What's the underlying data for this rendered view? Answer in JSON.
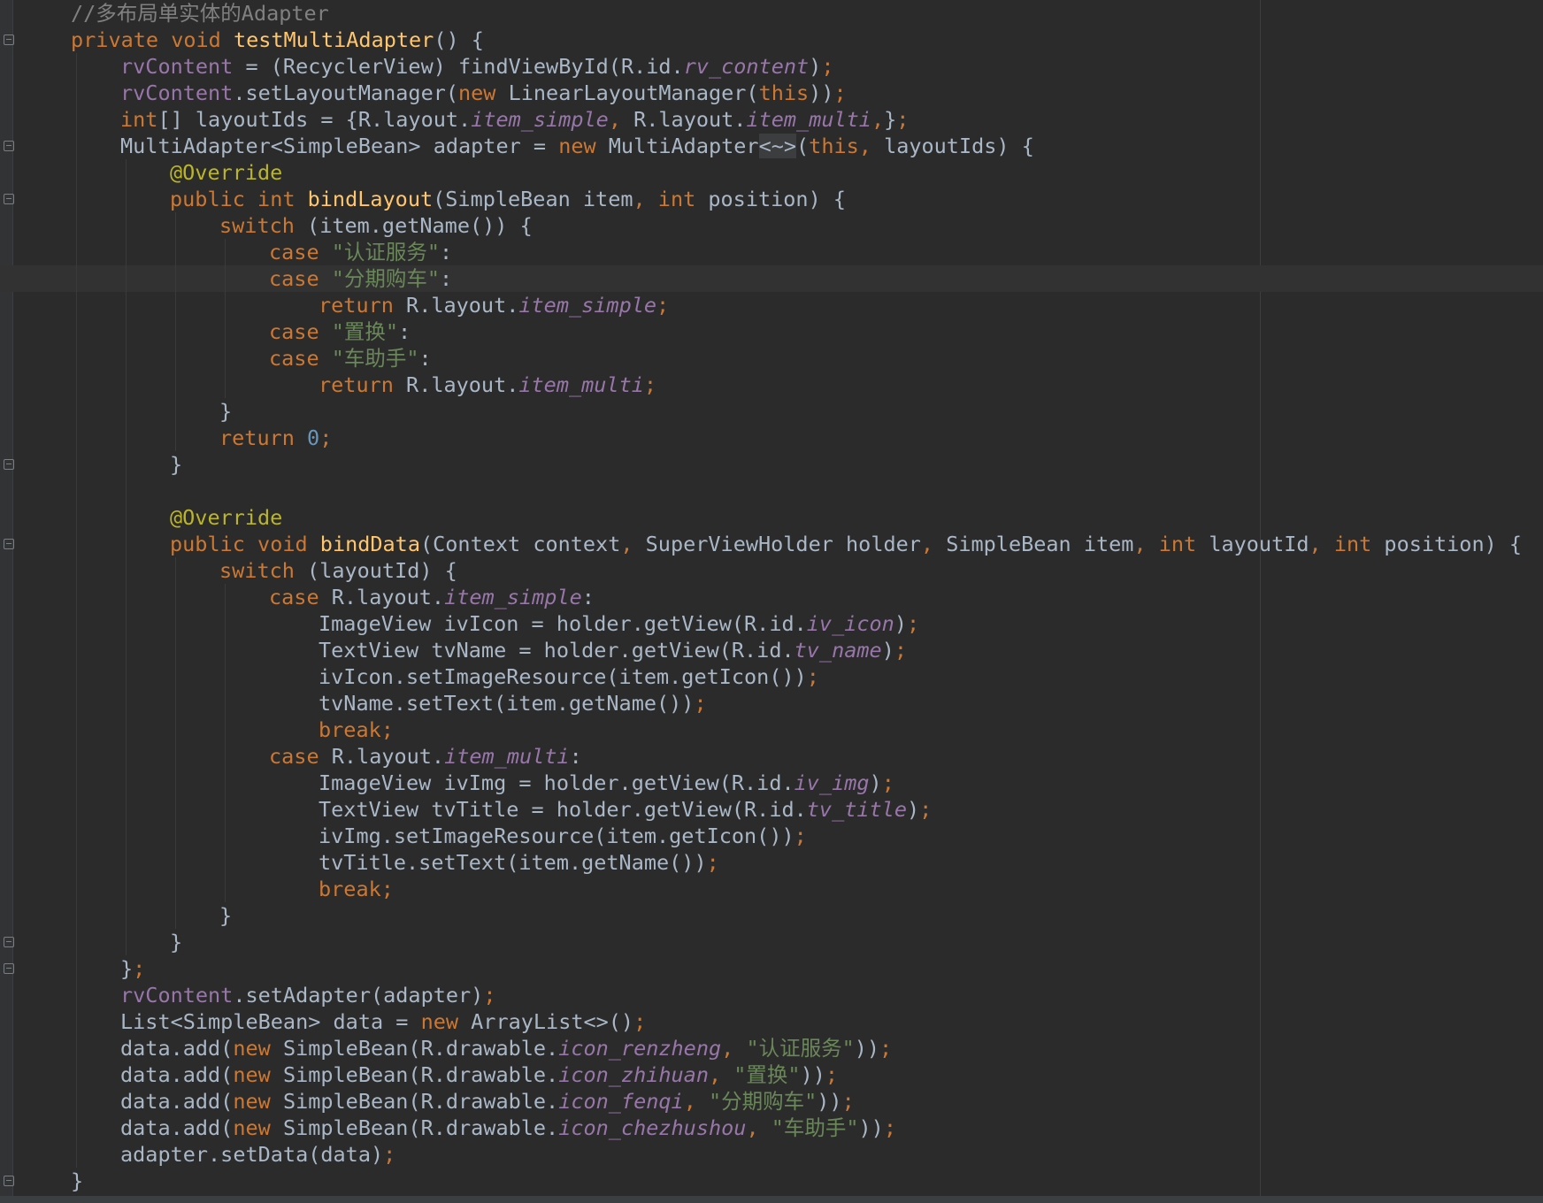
{
  "editor": {
    "lines": [
      {
        "indent": 0,
        "tokens": [
          {
            "t": "//多布局单实体的Adapter",
            "c": "c"
          }
        ]
      },
      {
        "indent": 0,
        "fold": true,
        "tokens": [
          {
            "t": "private ",
            "c": "k"
          },
          {
            "t": "void ",
            "c": "k"
          },
          {
            "t": "testMultiAdapter",
            "c": "m"
          },
          {
            "t": "() {",
            "c": "p"
          }
        ]
      },
      {
        "indent": 1,
        "tokens": [
          {
            "t": "rvContent",
            "c": "f"
          },
          {
            "t": " = (RecyclerView) findViewById(R.id.",
            "c": "p"
          },
          {
            "t": "rv_content",
            "c": "fi"
          },
          {
            "t": ")",
            "c": "p"
          },
          {
            "t": ";",
            "c": "k"
          }
        ]
      },
      {
        "indent": 1,
        "tokens": [
          {
            "t": "rvContent",
            "c": "f"
          },
          {
            "t": ".setLayoutManager(",
            "c": "p"
          },
          {
            "t": "new ",
            "c": "k"
          },
          {
            "t": "LinearLayoutManager(",
            "c": "p"
          },
          {
            "t": "this",
            "c": "k"
          },
          {
            "t": "))",
            "c": "p"
          },
          {
            "t": ";",
            "c": "k"
          }
        ]
      },
      {
        "indent": 1,
        "tokens": [
          {
            "t": "int",
            "c": "k"
          },
          {
            "t": "[] layoutIds = {R.layout.",
            "c": "p"
          },
          {
            "t": "item_simple",
            "c": "fi"
          },
          {
            "t": ", ",
            "c": "k"
          },
          {
            "t": "R.layout.",
            "c": "p"
          },
          {
            "t": "item_multi",
            "c": "fi"
          },
          {
            "t": ",",
            "c": "k"
          },
          {
            "t": "}",
            "c": "p"
          },
          {
            "t": ";",
            "c": "k"
          }
        ]
      },
      {
        "indent": 1,
        "fold": true,
        "tokens": [
          {
            "t": "MultiAdapter<SimpleBean> adapter = ",
            "c": "p"
          },
          {
            "t": "new ",
            "c": "k"
          },
          {
            "t": "MultiAdapter",
            "c": "p"
          },
          {
            "t": "<~>",
            "c": "d"
          },
          {
            "t": "(",
            "c": "p"
          },
          {
            "t": "this",
            "c": "k"
          },
          {
            "t": ", ",
            "c": "k"
          },
          {
            "t": "layoutIds) {",
            "c": "p"
          }
        ]
      },
      {
        "indent": 2,
        "tokens": [
          {
            "t": "@Override",
            "c": "a"
          }
        ]
      },
      {
        "indent": 2,
        "fold": true,
        "tokens": [
          {
            "t": "public ",
            "c": "k"
          },
          {
            "t": "int ",
            "c": "k"
          },
          {
            "t": "bindLayout",
            "c": "m"
          },
          {
            "t": "(SimpleBean item",
            "c": "p"
          },
          {
            "t": ", ",
            "c": "k"
          },
          {
            "t": "int ",
            "c": "k"
          },
          {
            "t": "position) {",
            "c": "p"
          }
        ]
      },
      {
        "indent": 3,
        "tokens": [
          {
            "t": "switch ",
            "c": "k"
          },
          {
            "t": "(item.getName()) {",
            "c": "p"
          }
        ]
      },
      {
        "indent": 4,
        "tokens": [
          {
            "t": "case ",
            "c": "k"
          },
          {
            "t": "\"认证服务\"",
            "c": "s"
          },
          {
            "t": ":",
            "c": "p"
          }
        ]
      },
      {
        "indent": 4,
        "current": true,
        "tokens": [
          {
            "t": "case ",
            "c": "k"
          },
          {
            "t": "\"分期购车\"",
            "c": "s"
          },
          {
            "t": ":",
            "c": "p"
          }
        ]
      },
      {
        "indent": 5,
        "tokens": [
          {
            "t": "return ",
            "c": "k"
          },
          {
            "t": "R.layout.",
            "c": "p"
          },
          {
            "t": "item_simple",
            "c": "fi"
          },
          {
            "t": ";",
            "c": "k"
          }
        ]
      },
      {
        "indent": 4,
        "tokens": [
          {
            "t": "case ",
            "c": "k"
          },
          {
            "t": "\"置换\"",
            "c": "s"
          },
          {
            "t": ":",
            "c": "p"
          }
        ]
      },
      {
        "indent": 4,
        "tokens": [
          {
            "t": "case ",
            "c": "k"
          },
          {
            "t": "\"车助手\"",
            "c": "s"
          },
          {
            "t": ":",
            "c": "p"
          }
        ]
      },
      {
        "indent": 5,
        "tokens": [
          {
            "t": "return ",
            "c": "k"
          },
          {
            "t": "R.layout.",
            "c": "p"
          },
          {
            "t": "item_multi",
            "c": "fi"
          },
          {
            "t": ";",
            "c": "k"
          }
        ]
      },
      {
        "indent": 3,
        "tokens": [
          {
            "t": "}",
            "c": "p"
          }
        ]
      },
      {
        "indent": 3,
        "tokens": [
          {
            "t": "return ",
            "c": "k"
          },
          {
            "t": "0",
            "c": "n"
          },
          {
            "t": ";",
            "c": "k"
          }
        ]
      },
      {
        "indent": 2,
        "foldEnd": true,
        "tokens": [
          {
            "t": "}",
            "c": "p"
          }
        ]
      },
      {
        "indent": 2,
        "tokens": []
      },
      {
        "indent": 2,
        "tokens": [
          {
            "t": "@Override",
            "c": "a"
          }
        ]
      },
      {
        "indent": 2,
        "fold": true,
        "tokens": [
          {
            "t": "public ",
            "c": "k"
          },
          {
            "t": "void ",
            "c": "k"
          },
          {
            "t": "bindData",
            "c": "m"
          },
          {
            "t": "(Context context",
            "c": "p"
          },
          {
            "t": ", ",
            "c": "k"
          },
          {
            "t": "SuperViewHolder holder",
            "c": "p"
          },
          {
            "t": ", ",
            "c": "k"
          },
          {
            "t": "SimpleBean item",
            "c": "p"
          },
          {
            "t": ", ",
            "c": "k"
          },
          {
            "t": "int ",
            "c": "k"
          },
          {
            "t": "layoutId",
            "c": "p"
          },
          {
            "t": ", ",
            "c": "k"
          },
          {
            "t": "int ",
            "c": "k"
          },
          {
            "t": "position) {",
            "c": "p"
          }
        ]
      },
      {
        "indent": 3,
        "tokens": [
          {
            "t": "switch ",
            "c": "k"
          },
          {
            "t": "(layoutId) {",
            "c": "p"
          }
        ]
      },
      {
        "indent": 4,
        "tokens": [
          {
            "t": "case ",
            "c": "k"
          },
          {
            "t": "R.layout.",
            "c": "p"
          },
          {
            "t": "item_simple",
            "c": "fi"
          },
          {
            "t": ":",
            "c": "p"
          }
        ]
      },
      {
        "indent": 5,
        "tokens": [
          {
            "t": "ImageView ivIcon = holder.getView(R.id.",
            "c": "p"
          },
          {
            "t": "iv_icon",
            "c": "fi"
          },
          {
            "t": ")",
            "c": "p"
          },
          {
            "t": ";",
            "c": "k"
          }
        ]
      },
      {
        "indent": 5,
        "tokens": [
          {
            "t": "TextView tvName = holder.getView(R.id.",
            "c": "p"
          },
          {
            "t": "tv_name",
            "c": "fi"
          },
          {
            "t": ")",
            "c": "p"
          },
          {
            "t": ";",
            "c": "k"
          }
        ]
      },
      {
        "indent": 5,
        "tokens": [
          {
            "t": "ivIcon.setImageResource(item.getIcon())",
            "c": "p"
          },
          {
            "t": ";",
            "c": "k"
          }
        ]
      },
      {
        "indent": 5,
        "tokens": [
          {
            "t": "tvName.setText(item.getName())",
            "c": "p"
          },
          {
            "t": ";",
            "c": "k"
          }
        ]
      },
      {
        "indent": 5,
        "tokens": [
          {
            "t": "break;",
            "c": "k"
          }
        ]
      },
      {
        "indent": 4,
        "tokens": [
          {
            "t": "case ",
            "c": "k"
          },
          {
            "t": "R.layout.",
            "c": "p"
          },
          {
            "t": "item_multi",
            "c": "fi"
          },
          {
            "t": ":",
            "c": "p"
          }
        ]
      },
      {
        "indent": 5,
        "tokens": [
          {
            "t": "ImageView ivImg = holder.getView(R.id.",
            "c": "p"
          },
          {
            "t": "iv_img",
            "c": "fi"
          },
          {
            "t": ")",
            "c": "p"
          },
          {
            "t": ";",
            "c": "k"
          }
        ]
      },
      {
        "indent": 5,
        "tokens": [
          {
            "t": "TextView tvTitle = holder.getView(R.id.",
            "c": "p"
          },
          {
            "t": "tv_title",
            "c": "fi"
          },
          {
            "t": ")",
            "c": "p"
          },
          {
            "t": ";",
            "c": "k"
          }
        ]
      },
      {
        "indent": 5,
        "tokens": [
          {
            "t": "ivImg.setImageResource(item.getIcon())",
            "c": "p"
          },
          {
            "t": ";",
            "c": "k"
          }
        ]
      },
      {
        "indent": 5,
        "tokens": [
          {
            "t": "tvTitle.setText(item.getName())",
            "c": "p"
          },
          {
            "t": ";",
            "c": "k"
          }
        ]
      },
      {
        "indent": 5,
        "tokens": [
          {
            "t": "break;",
            "c": "k"
          }
        ]
      },
      {
        "indent": 3,
        "tokens": [
          {
            "t": "}",
            "c": "p"
          }
        ]
      },
      {
        "indent": 2,
        "foldEnd": true,
        "tokens": [
          {
            "t": "}",
            "c": "p"
          }
        ]
      },
      {
        "indent": 1,
        "foldEnd": true,
        "tokens": [
          {
            "t": "}",
            "c": "p"
          },
          {
            "t": ";",
            "c": "k"
          }
        ]
      },
      {
        "indent": 1,
        "tokens": [
          {
            "t": "rvContent",
            "c": "f"
          },
          {
            "t": ".setAdapter(adapter)",
            "c": "p"
          },
          {
            "t": ";",
            "c": "k"
          }
        ]
      },
      {
        "indent": 1,
        "tokens": [
          {
            "t": "List<SimpleBean> data = ",
            "c": "p"
          },
          {
            "t": "new ",
            "c": "k"
          },
          {
            "t": "ArrayList<>()",
            "c": "p"
          },
          {
            "t": ";",
            "c": "k"
          }
        ]
      },
      {
        "indent": 1,
        "tokens": [
          {
            "t": "data.add(",
            "c": "p"
          },
          {
            "t": "new ",
            "c": "k"
          },
          {
            "t": "SimpleBean(R.drawable.",
            "c": "p"
          },
          {
            "t": "icon_renzheng",
            "c": "fi"
          },
          {
            "t": ", ",
            "c": "k"
          },
          {
            "t": "\"认证服务\"",
            "c": "s"
          },
          {
            "t": "))",
            "c": "p"
          },
          {
            "t": ";",
            "c": "k"
          }
        ]
      },
      {
        "indent": 1,
        "tokens": [
          {
            "t": "data.add(",
            "c": "p"
          },
          {
            "t": "new ",
            "c": "k"
          },
          {
            "t": "SimpleBean(R.drawable.",
            "c": "p"
          },
          {
            "t": "icon_zhihuan",
            "c": "fi"
          },
          {
            "t": ", ",
            "c": "k"
          },
          {
            "t": "\"置换\"",
            "c": "s"
          },
          {
            "t": "))",
            "c": "p"
          },
          {
            "t": ";",
            "c": "k"
          }
        ]
      },
      {
        "indent": 1,
        "tokens": [
          {
            "t": "data.add(",
            "c": "p"
          },
          {
            "t": "new ",
            "c": "k"
          },
          {
            "t": "SimpleBean(R.drawable.",
            "c": "p"
          },
          {
            "t": "icon_fenqi",
            "c": "fi"
          },
          {
            "t": ", ",
            "c": "k"
          },
          {
            "t": "\"分期购车\"",
            "c": "s"
          },
          {
            "t": "))",
            "c": "p"
          },
          {
            "t": ";",
            "c": "k"
          }
        ]
      },
      {
        "indent": 1,
        "tokens": [
          {
            "t": "data.add(",
            "c": "p"
          },
          {
            "t": "new ",
            "c": "k"
          },
          {
            "t": "SimpleBean(R.drawable.",
            "c": "p"
          },
          {
            "t": "icon_chezhushou",
            "c": "fi"
          },
          {
            "t": ", ",
            "c": "k"
          },
          {
            "t": "\"车助手\"",
            "c": "s"
          },
          {
            "t": "))",
            "c": "p"
          },
          {
            "t": ";",
            "c": "k"
          }
        ]
      },
      {
        "indent": 1,
        "tokens": [
          {
            "t": "adapter.setData(data)",
            "c": "p"
          },
          {
            "t": ";",
            "c": "k"
          }
        ]
      },
      {
        "indent": 0,
        "foldEnd": true,
        "tokens": [
          {
            "t": "}",
            "c": "p"
          }
        ]
      }
    ]
  },
  "colors": {
    "background": "#2b2b2b",
    "keyword": "#cc7832",
    "method": "#ffc66d",
    "field": "#9876aa",
    "string": "#6a8759",
    "number": "#6897bb",
    "comment": "#808080",
    "annotation": "#bbb529",
    "text": "#a9b7c6"
  }
}
